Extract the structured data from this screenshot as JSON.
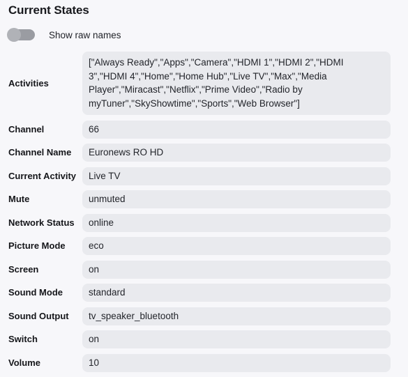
{
  "panel": {
    "title": "Current States"
  },
  "toggle": {
    "label": "Show raw names",
    "state": "off",
    "track_color": "#9a9ca2",
    "knob_color": "#b0b2b7"
  },
  "colors": {
    "page_background": "#f7f7fa",
    "value_background": "#e9eaee",
    "label_text": "#15161a",
    "value_text": "#23252b"
  },
  "fields": [
    {
      "label": "Activities",
      "value": "[\"Always Ready\",\"Apps\",\"Camera\",\"HDMI 1\",\"HDMI 2\",\"HDMI 3\",\"HDMI 4\",\"Home\",\"Home Hub\",\"Live TV\",\"Max\",\"Media Player\",\"Miracast\",\"Netflix\",\"Prime Video\",\"Radio by myTuner\",\"SkyShowtime\",\"Sports\",\"Web Browser\"]",
      "multiline": true
    },
    {
      "label": "Channel",
      "value": "66",
      "multiline": false
    },
    {
      "label": "Channel Name",
      "value": "Euronews RO HD",
      "multiline": false
    },
    {
      "label": "Current Activity",
      "value": "Live TV",
      "multiline": false
    },
    {
      "label": "Mute",
      "value": "unmuted",
      "multiline": false
    },
    {
      "label": "Network Status",
      "value": "online",
      "multiline": false
    },
    {
      "label": "Picture Mode",
      "value": "eco",
      "multiline": false
    },
    {
      "label": "Screen",
      "value": "on",
      "multiline": false
    },
    {
      "label": "Sound Mode",
      "value": "standard",
      "multiline": false
    },
    {
      "label": "Sound Output",
      "value": "tv_speaker_bluetooth",
      "multiline": false
    },
    {
      "label": "Switch",
      "value": "on",
      "multiline": false
    },
    {
      "label": "Volume",
      "value": "10",
      "multiline": false
    }
  ]
}
